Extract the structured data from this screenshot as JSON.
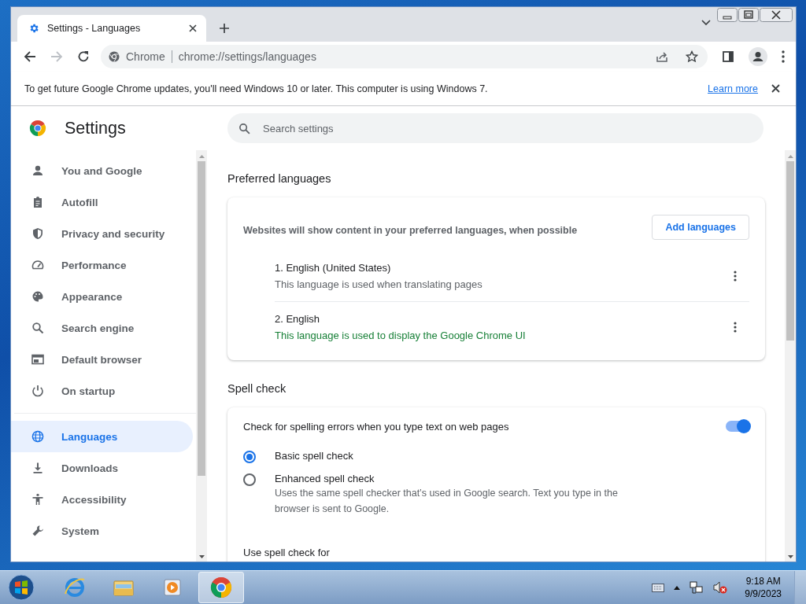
{
  "browser": {
    "tab_title": "Settings - Languages",
    "site_label": "Chrome",
    "url": "chrome://settings/languages"
  },
  "infobar": {
    "message": "To get future Google Chrome updates, you'll need Windows 10 or later. This computer is using Windows 7.",
    "link": "Learn more"
  },
  "settings": {
    "title": "Settings",
    "search_placeholder": "Search settings",
    "nav": [
      {
        "label": "You and Google",
        "selected": false
      },
      {
        "label": "Autofill",
        "selected": false
      },
      {
        "label": "Privacy and security",
        "selected": false
      },
      {
        "label": "Performance",
        "selected": false
      },
      {
        "label": "Appearance",
        "selected": false
      },
      {
        "label": "Search engine",
        "selected": false
      },
      {
        "label": "Default browser",
        "selected": false
      },
      {
        "label": "On startup",
        "selected": false
      },
      {
        "label": "Languages",
        "selected": true
      },
      {
        "label": "Downloads",
        "selected": false
      },
      {
        "label": "Accessibility",
        "selected": false
      },
      {
        "label": "System",
        "selected": false
      }
    ]
  },
  "preferred_languages": {
    "heading": "Preferred languages",
    "description": "Websites will show content in your preferred languages, when possible",
    "add_button": "Add languages",
    "languages": [
      {
        "name": "1. English (United States)",
        "note": "This language is used when translating pages",
        "ui_language": false
      },
      {
        "name": "2. English",
        "note": "This language is used to display the Google Chrome UI",
        "ui_language": true
      }
    ]
  },
  "spell_check": {
    "heading": "Spell check",
    "toggle": {
      "label": "Check for spelling errors when you type text on web pages",
      "on": true
    },
    "options": [
      {
        "label": "Basic spell check",
        "selected": true
      },
      {
        "label": "Enhanced spell check",
        "description": "Uses the same spell checker that’s used in Google search. Text you type in the browser is sent to Google.",
        "selected": false
      }
    ],
    "subheading": "Use spell check for"
  },
  "taskbar": {
    "apps": [
      {
        "selected": false
      },
      {
        "selected": false
      },
      {
        "selected": false
      },
      {
        "selected": true
      }
    ],
    "time": "9:18 AM",
    "date": "9/9/2023"
  }
}
